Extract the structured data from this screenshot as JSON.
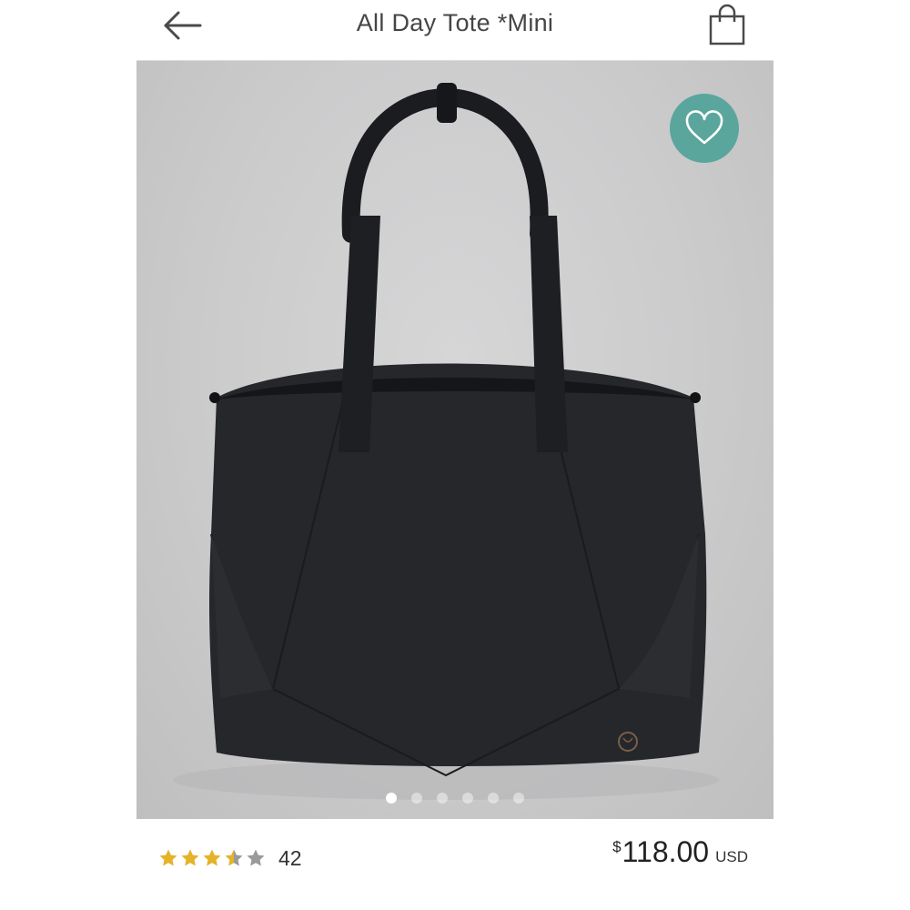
{
  "header": {
    "title": "All Day Tote *Mini",
    "back_icon": "arrow-left-icon",
    "bag_icon": "shopping-bag-icon"
  },
  "gallery": {
    "image_count": 6,
    "active_index": 0,
    "favorite_icon": "heart-icon",
    "favorite_color": "#5aa69c"
  },
  "product": {
    "rating_value": 3.5,
    "rating_max": 5,
    "review_count": "42",
    "price_symbol": "$",
    "price_amount": "118.00",
    "price_currency": "USD"
  },
  "colors": {
    "star_filled": "#e5b32a",
    "star_empty": "#9a9a9a",
    "accent": "#5aa69c"
  }
}
